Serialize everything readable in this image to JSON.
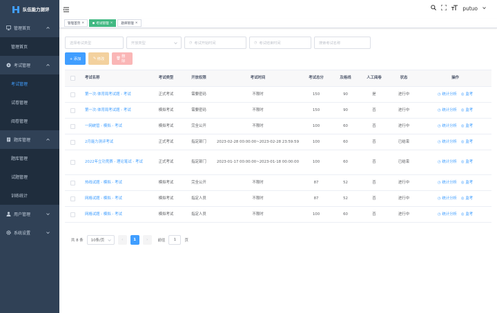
{
  "brand": {
    "title": "队伍能力测评"
  },
  "sidebar": {
    "groups": [
      {
        "label": "管理首页",
        "icon": "desktop-icon",
        "items": [
          "管理首页"
        ]
      },
      {
        "label": "考试管理",
        "icon": "exam-icon",
        "items": [
          "考试管理",
          "试卷管理",
          "阅卷管理"
        ]
      },
      {
        "label": "题库管理",
        "icon": "bank-icon",
        "items": [
          "题库管理",
          "试题管理",
          "训练统计"
        ]
      },
      {
        "label": "用户管理",
        "icon": "user-icon",
        "items": []
      },
      {
        "label": "系统设置",
        "icon": "gear-icon",
        "items": []
      }
    ],
    "active_item": "考试管理"
  },
  "header": {
    "user": "putuo"
  },
  "tags": [
    {
      "label": "管理首页",
      "active": false
    },
    {
      "label": "考试管理",
      "active": true
    },
    {
      "label": "题库管理",
      "active": false
    }
  ],
  "filters": {
    "exam_select": "选择考试类型",
    "open_type": "开放类型",
    "start_time": "考试开始时间",
    "end_time": "考试结束时间",
    "search": "搜索考试名称"
  },
  "actions": {
    "add": "+ 添加",
    "edit": "修改",
    "delete": "删除"
  },
  "table": {
    "columns": [
      "考试名称",
      "考试类型",
      "开放权限",
      "考试时间",
      "考试总分",
      "及格线",
      "人工阅卷",
      "状态",
      "操作"
    ],
    "rows": [
      {
        "name": "第一次-体育局考试题 - 考试",
        "type": "正式考试",
        "perm": "需要密码",
        "time": "不限时",
        "total": "150",
        "pass": "90",
        "manual": "是",
        "status": "进行中"
      },
      {
        "name": "第一次-体育局考试题 - 考试",
        "type": "模拟考试",
        "perm": "需要密码",
        "time": "不限时",
        "total": "150",
        "pass": "90",
        "manual": "否",
        "status": "进行中"
      },
      {
        "name": "一网统管 - 模拟 - 考试",
        "type": "模拟考试",
        "perm": "完全公开",
        "time": "不限时",
        "total": "100",
        "pass": "60",
        "manual": "否",
        "status": "进行中"
      },
      {
        "name": "2月能力测评考试",
        "type": "正式考试",
        "perm": "指定部门",
        "time": "2023-02-28 00:00:00~2023-02-28 23:59:59",
        "total": "100",
        "pass": "60",
        "manual": "否",
        "status": "已结束"
      },
      {
        "name": "2022年立功竞赛 - 理论笔试 - 考试",
        "type": "正式考试",
        "perm": "指定部门",
        "time": "2023-01-17 00:00:00~2023-01-18 00:00:00",
        "total": "100",
        "pass": "60",
        "manual": "否",
        "status": "已结束"
      },
      {
        "name": "热线试题 - 模拟 - 考试",
        "type": "模拟考试",
        "perm": "完全公开",
        "time": "不限时",
        "total": "87",
        "pass": "52",
        "manual": "否",
        "status": "进行中"
      },
      {
        "name": "网格试题 - 模拟 - 考试",
        "type": "模拟考试",
        "perm": "指定人员",
        "time": "不限时",
        "total": "87",
        "pass": "52",
        "manual": "否",
        "status": "进行中"
      },
      {
        "name": "网格试题 - 模拟 - 考试",
        "type": "模拟考试",
        "perm": "指定人员",
        "time": "不限时",
        "total": "100",
        "pass": "60",
        "manual": "否",
        "status": "进行中"
      }
    ],
    "op_stats": "统计分析",
    "op_monitor": "监考"
  },
  "pager": {
    "total": "共 8 条",
    "page_size": "10条/页",
    "current": "1",
    "goto_label": "前往",
    "goto_value": "1",
    "page_label": "页"
  },
  "colors": {
    "sidebar": "#304156",
    "accent": "#409eff",
    "tag_active": "#42b983"
  }
}
